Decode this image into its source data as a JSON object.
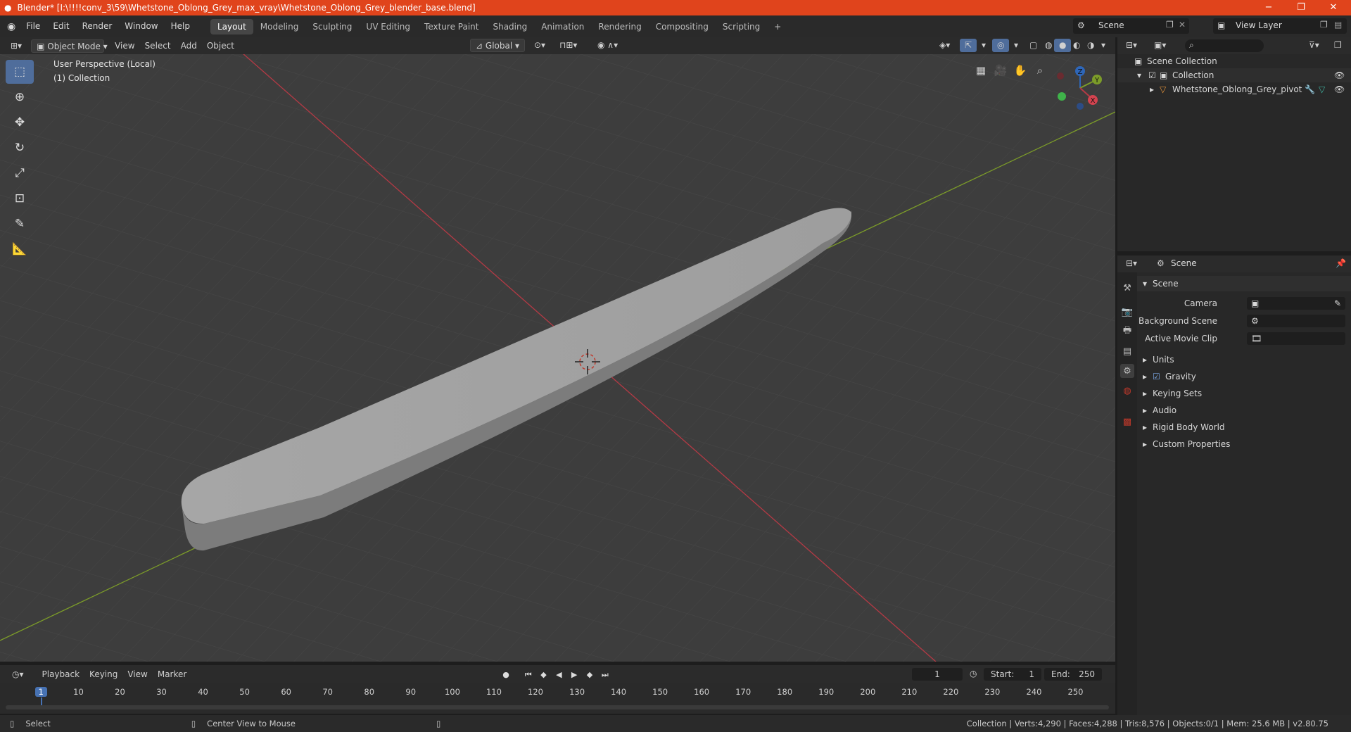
{
  "window": {
    "title": "Blender* [I:\\!!!!conv_3\\59\\Whetstone_Oblong_Grey_max_vray\\Whetstone_Oblong_Grey_blender_base.blend]",
    "minimize": "−",
    "maximize": "❐",
    "close": "✕"
  },
  "menu": {
    "items": [
      "File",
      "Edit",
      "Render",
      "Window",
      "Help"
    ],
    "workspaces": [
      "Layout",
      "Modeling",
      "Sculpting",
      "UV Editing",
      "Texture Paint",
      "Shading",
      "Animation",
      "Rendering",
      "Compositing",
      "Scripting"
    ],
    "add_tab": "+",
    "scene": "Scene",
    "view_layer": "View Layer"
  },
  "viewport_header": {
    "mode": "Object Mode",
    "menus": [
      "View",
      "Select",
      "Add",
      "Object"
    ],
    "transform": "Global"
  },
  "viewport": {
    "perspective": "User Perspective (Local)",
    "collection": "(1) Collection",
    "gizmo": {
      "z": "Z",
      "y": "Y",
      "x": "X"
    }
  },
  "outliner": {
    "scene_collection": "Scene Collection",
    "collection": "Collection",
    "object": "Whetstone_Oblong_Grey_pivot"
  },
  "properties": {
    "header": "Scene",
    "section": "Scene",
    "camera_label": "Camera",
    "background_scene_label": "Background Scene",
    "active_movie_clip_label": "Active Movie Clip",
    "panels": [
      "Units",
      "Gravity",
      "Keying Sets",
      "Audio",
      "Rigid Body World",
      "Custom Properties"
    ]
  },
  "timeline": {
    "menus": [
      "Playback",
      "Keying",
      "View",
      "Marker"
    ],
    "current_frame": "1",
    "start_label": "Start:",
    "start": "1",
    "end_label": "End:",
    "end": "250",
    "ticks": [
      "1",
      "10",
      "20",
      "30",
      "40",
      "50",
      "60",
      "70",
      "80",
      "90",
      "100",
      "110",
      "120",
      "130",
      "140",
      "150",
      "160",
      "170",
      "180",
      "190",
      "200",
      "210",
      "220",
      "230",
      "240",
      "250"
    ]
  },
  "status": {
    "select": "Select",
    "center_view": "Center View to Mouse",
    "stats": "Collection | Verts:4,290 | Faces:4,288 | Tris:8,576 | Objects:0/1 | Mem: 25.6 MB | v2.80.75"
  },
  "colors": {
    "title_bar": "#e0441c",
    "active_tool": "#4f6d9b",
    "x_axis": "#b43a45",
    "y_axis": "#7c9c29",
    "frame_marker": "#4772b3"
  }
}
